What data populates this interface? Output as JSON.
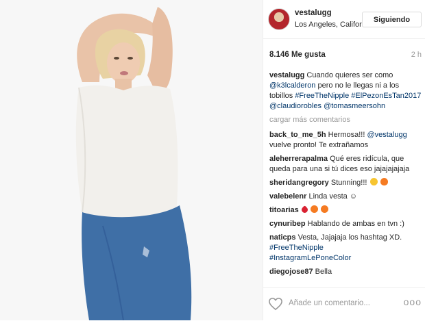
{
  "post": {
    "username": "vestalugg",
    "location": "Los Angeles, Californ...",
    "follow_label": "Siguiendo",
    "likes": "8.146 Me gusta",
    "time": "2 h"
  },
  "caption": {
    "username": "vestalugg",
    "text_1": "Cuando quieres ser como",
    "mention_1": "@k3lcalderon",
    "text_2": "pero no le llegas ni a los tobillos",
    "hashtag_1": "#FreeTheNipple",
    "hashtag_2": "#ElPezonEsTan2017",
    "mention_2": "@claudiorobles",
    "mention_3": "@tomasmeersohn"
  },
  "load_more": "cargar más comentarios",
  "comments": [
    {
      "user": "back_to_me_5h",
      "text": "Hermosa!!!",
      "mention": "@vestalugg",
      "text2": "vuelve pronto! Te extrañamos"
    },
    {
      "user": "aleherrerapalma",
      "text": "Qué eres ridícula, que queda para una si tú dices eso jajajajajaja"
    },
    {
      "user": "sheridangregory",
      "text": "Stunning!!!"
    },
    {
      "user": "valebelenr",
      "text": "Linda vesta ☺"
    },
    {
      "user": "titoarias",
      "text": ""
    },
    {
      "user": "cynuribep",
      "text": "Hablando de ambas en tvn :)"
    },
    {
      "user": "naticps",
      "text": "Vesta, Jajajaja los hashtag XD.",
      "hashtag": "#FreeTheNipple",
      "hashtag2": "#InstagramLePoneColor"
    },
    {
      "user": "diegojose87",
      "text": "Bella"
    }
  ],
  "footer": {
    "placeholder": "Añade un comentario...",
    "more": "ooo"
  },
  "icons": {
    "heart": "heart-icon",
    "more": "more-icon",
    "fire": "fire-emoji",
    "heart_eyes": "heart-eyes-emoji",
    "red_heart": "red-heart-emoji"
  },
  "colors": {
    "link": "#003569",
    "muted": "#999999",
    "jeans": "#3f6fa6",
    "shirt": "#f2f0ec"
  }
}
